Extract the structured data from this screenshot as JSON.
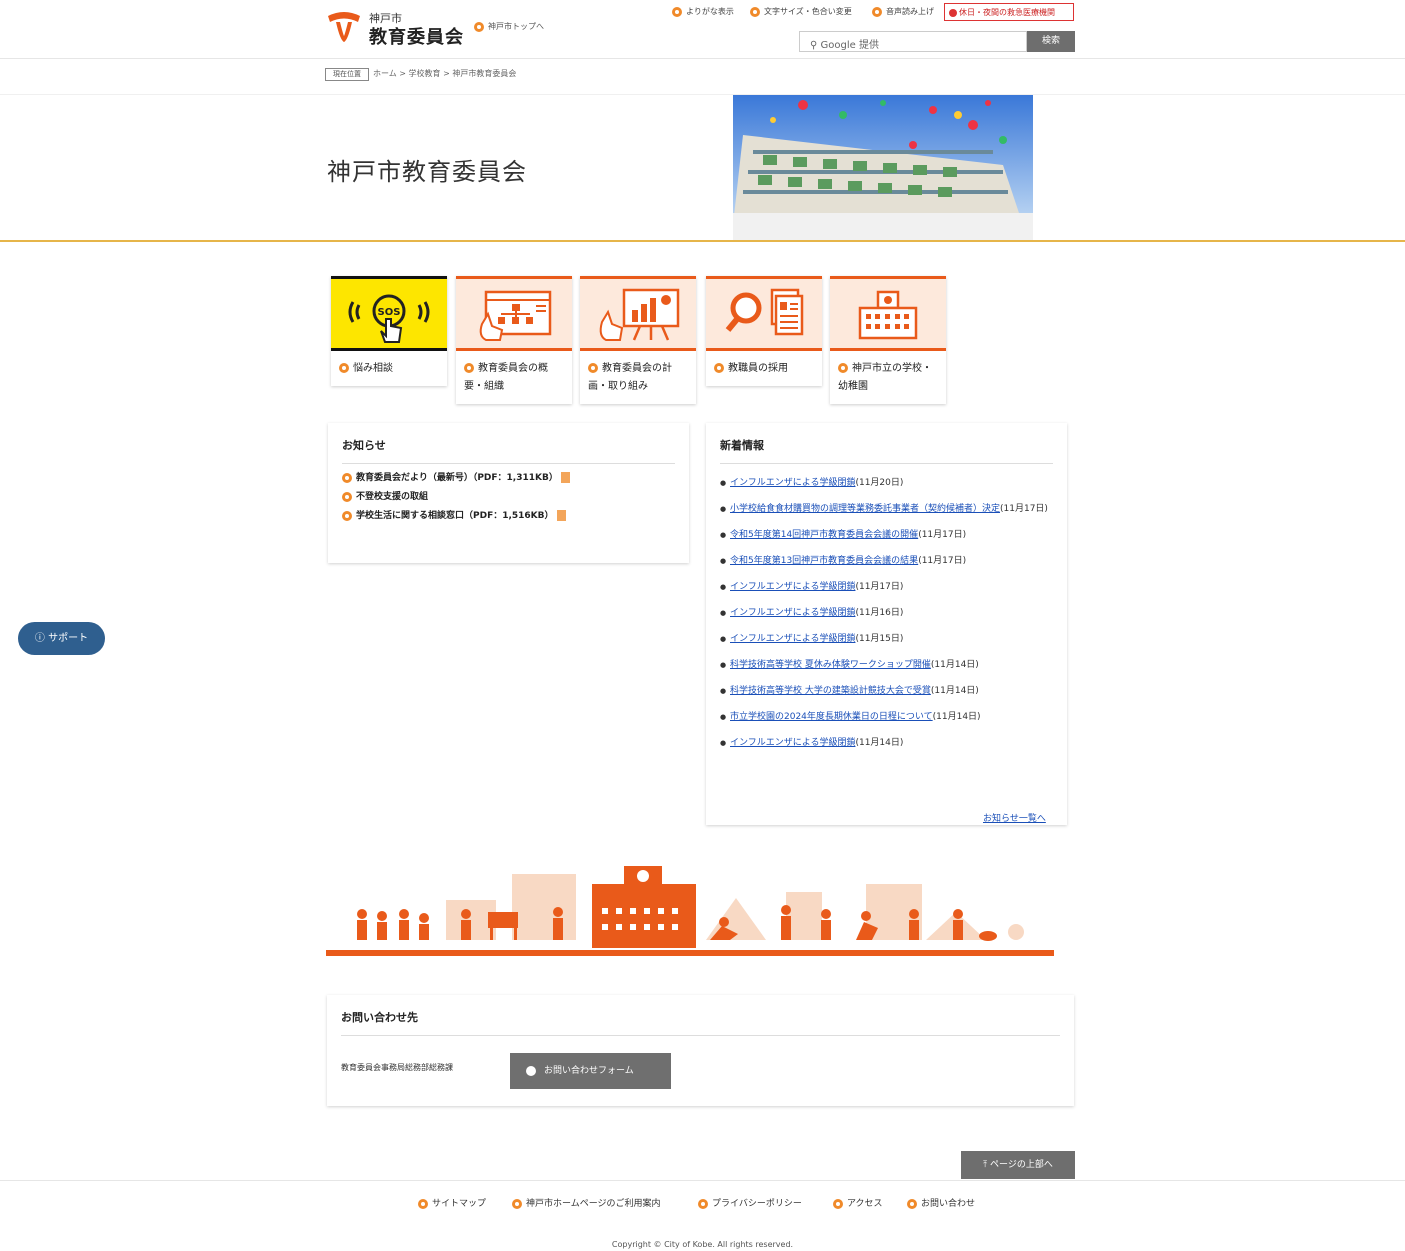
{
  "header": {
    "logo_city": "神戸市",
    "logo_name": "教育委員会",
    "kobe_top_link": "神戸市トップへ",
    "util_links": [
      "よりがな表示",
      "文字サイズ・色合い変更",
      "音声読み上げ"
    ],
    "emergency_link": "休日・夜間の救急医療機関",
    "search_placeholder": "Google 提供",
    "search_button": "検索"
  },
  "breadcrumb": {
    "tag": "現在位置",
    "path": "ホーム > 学校教育 > 神戸市教育委員会"
  },
  "page_title": "神戸市教育委員会",
  "tiles": [
    {
      "label": "悩み相談",
      "icon": "sos-hand-icon"
    },
    {
      "label": "教育委員会の概要・組織",
      "icon": "org-chart-icon"
    },
    {
      "label": "教育委員会の計画・取り組み",
      "icon": "presentation-icon"
    },
    {
      "label": "教職員の採用",
      "icon": "magnifier-document-icon"
    },
    {
      "label": "神戸市立の学校・幼稚園",
      "icon": "school-building-icon"
    }
  ],
  "notices": {
    "title": "お知らせ",
    "items": [
      {
        "text": "教育委員会だより（最新号）（PDF：1,311KB）",
        "pdf": true
      },
      {
        "text": "不登校支援の取組",
        "pdf": false
      },
      {
        "text": "学校生活に関する相談窓口（PDF：1,516KB）",
        "pdf": true
      }
    ]
  },
  "news": {
    "title": "新着情報",
    "items": [
      {
        "link": "インフルエンザによる学級閉鎖",
        "date": "(11月20日)"
      },
      {
        "link": "小学校給食食材購買物の調理等業務委託事業者（契約候補者）決定",
        "date": "(11月17日)"
      },
      {
        "link": "令和5年度第14回神戸市教育委員会会議の開催",
        "date": "(11月17日)"
      },
      {
        "link": "令和5年度第13回神戸市教育委員会会議の結果",
        "date": "(11月17日)"
      },
      {
        "link": "インフルエンザによる学級閉鎖",
        "date": "(11月17日)"
      },
      {
        "link": "インフルエンザによる学級閉鎖",
        "date": "(11月16日)"
      },
      {
        "link": "インフルエンザによる学級閉鎖",
        "date": "(11月15日)"
      },
      {
        "link": "科学技術高等学校 夏休み体験ワークショップ開催",
        "date": "(11月14日)"
      },
      {
        "link": "科学技術高等学校 大学の建築設計競技大会で受賞",
        "date": "(11月14日)"
      },
      {
        "link": "市立学校園の2024年度長期休業日の日程について",
        "date": "(11月14日)"
      },
      {
        "link": "インフルエンザによる学級閉鎖",
        "date": "(11月14日)"
      }
    ],
    "more": "お知らせ一覧へ"
  },
  "contact": {
    "title": "お問い合わせ先",
    "department": "教育委員会事務局総務部総務課",
    "form_button": "お問い合わせフォーム"
  },
  "support_button": "サポート",
  "page_top": "ページの上部へ",
  "footer": {
    "links": [
      "サイトマップ",
      "神戸市ホームページのご利用案内",
      "プライバシーポリシー",
      "アクセス",
      "お問い合わせ"
    ],
    "copyright": "Copyright © City of Kobe. All rights reserved."
  },
  "colors": {
    "accent": "#e95a1a",
    "gold_rule": "#e6b54a",
    "link": "#1a4fb8",
    "sos_yellow": "#fde600",
    "support": "#2f5f8f"
  }
}
